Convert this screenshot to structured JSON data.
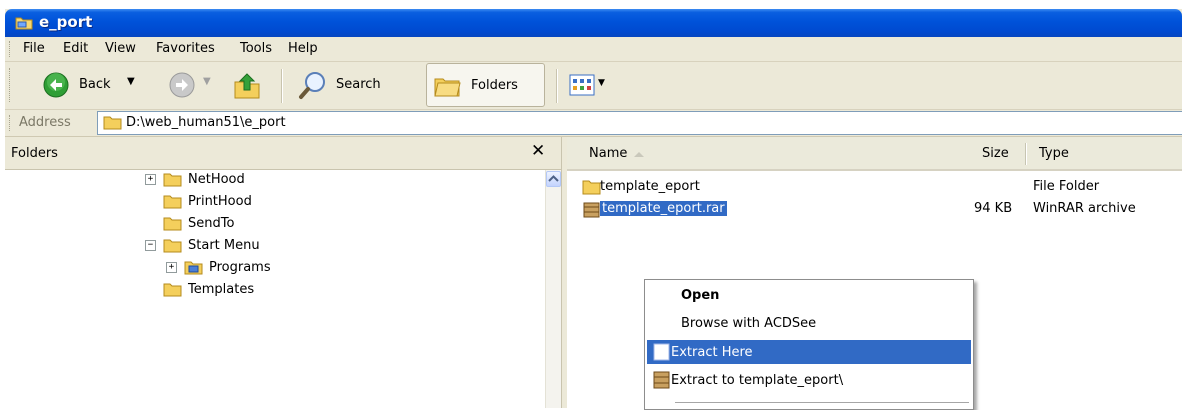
{
  "window": {
    "title": "e_port"
  },
  "menubar": {
    "items": [
      "File",
      "Edit",
      "View",
      "Favorites",
      "Tools",
      "Help"
    ]
  },
  "toolbar": {
    "back": "Back",
    "search": "Search",
    "folders": "Folders"
  },
  "address": {
    "label": "Address",
    "value": "D:\\web_human51\\e_port"
  },
  "folders_pane": {
    "title": "Folders",
    "tree": [
      {
        "label": "NetHood",
        "expander": "+"
      },
      {
        "label": "PrintHood",
        "expander": ""
      },
      {
        "label": "SendTo",
        "expander": ""
      },
      {
        "label": "Start Menu",
        "expander": "−"
      },
      {
        "label": "Programs",
        "expander": "+"
      },
      {
        "label": "Templates",
        "expander": ""
      }
    ]
  },
  "file_list": {
    "columns": {
      "name": "Name",
      "size": "Size",
      "type": "Type"
    },
    "rows": [
      {
        "name": "template_eport",
        "size": "",
        "type": "File Folder",
        "icon": "folder-icon"
      },
      {
        "name": "template_eport.rar",
        "size": "94 KB",
        "type": "WinRAR archive",
        "icon": "winrar-archive-icon"
      }
    ]
  },
  "context_menu": {
    "items": [
      {
        "label": "Open",
        "bold": true
      },
      {
        "label": "Browse with ACDSee"
      },
      {
        "label": "Extract Here",
        "highlighted": true
      },
      {
        "label": "Extract to template_eport\\"
      }
    ]
  },
  "colors": {
    "titlebar": "#0052d9",
    "selection": "#316ac5",
    "chrome": "#ece9d8",
    "folder": "#f5d26a"
  }
}
